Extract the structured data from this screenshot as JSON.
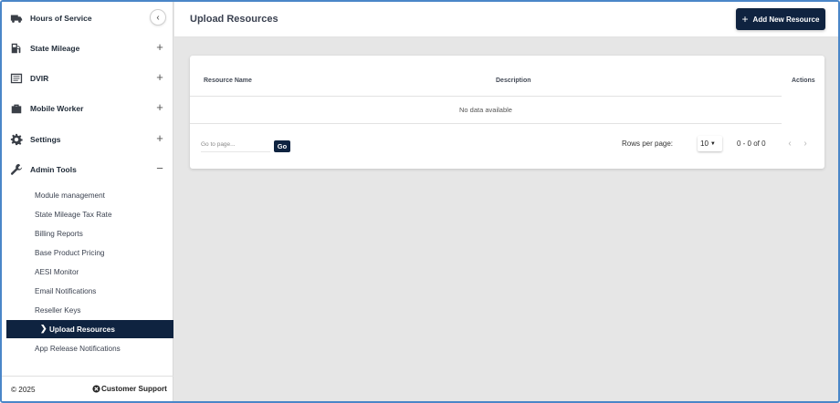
{
  "sidebar": {
    "collapse_icon": "chevron-left-icon",
    "items": [
      {
        "label": "Hours of Service",
        "icon": "truck-icon",
        "toggle": ""
      },
      {
        "label": "State Mileage",
        "icon": "fuel-pump-icon",
        "toggle": "+"
      },
      {
        "label": "DVIR",
        "icon": "list-document-icon",
        "toggle": "+"
      },
      {
        "label": "Mobile Worker",
        "icon": "briefcase-icon",
        "toggle": "+"
      },
      {
        "label": "Settings",
        "icon": "gear-icon",
        "toggle": "+"
      },
      {
        "label": "Admin Tools",
        "icon": "wrench-icon",
        "toggle": "−"
      }
    ],
    "admin_sub_items": [
      {
        "label": "Module management"
      },
      {
        "label": "State Mileage Tax Rate"
      },
      {
        "label": "Billing Reports"
      },
      {
        "label": "Base Product Pricing"
      },
      {
        "label": "AESI Monitor"
      },
      {
        "label": "Email Notifications"
      },
      {
        "label": "Reseller Keys"
      },
      {
        "label": "Upload Resources",
        "active": true
      },
      {
        "label": "App Release Notifications"
      }
    ],
    "footer": {
      "copyright": "© 2025",
      "support_label": "Customer Support"
    }
  },
  "header": {
    "title": "Upload Resources",
    "add_button_label": "Add New Resource"
  },
  "table": {
    "columns": [
      "Resource Name",
      "Description",
      "Actions"
    ],
    "empty_text": "No data available",
    "go_to_placeholder": "Go to page...",
    "go_label": "Go",
    "rows_per_page_label": "Rows per page:",
    "rows_per_page_value": "10",
    "range_text": "0 - 0 of 0"
  },
  "colors": {
    "accent": "#0f2340",
    "background": "#e6e6e6",
    "frame_border": "#4a86c8"
  }
}
